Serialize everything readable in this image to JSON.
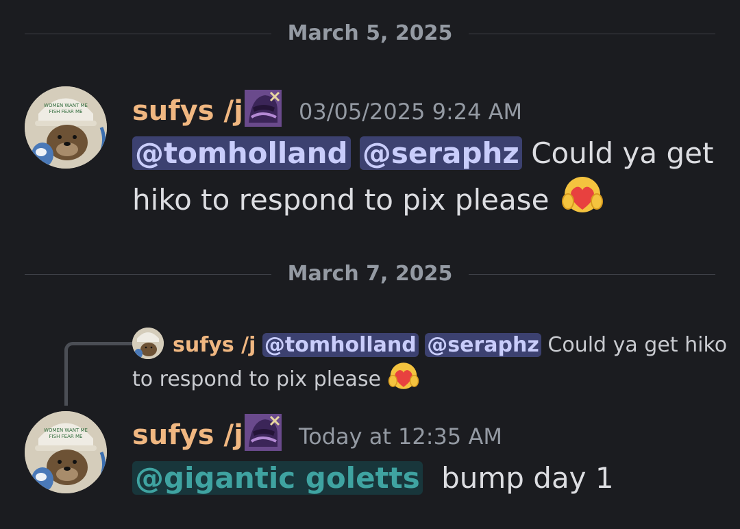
{
  "dividers": [
    {
      "label": "March 5, 2025"
    },
    {
      "label": "March 7, 2025"
    }
  ],
  "message1": {
    "author": "sufys /j",
    "timestamp": "03/05/2025 9:24 AM",
    "mentions": [
      "@tomholland",
      "@seraphz"
    ],
    "text_line1": "Could ya get",
    "text_line2": "hiko to respond to pix please",
    "emoji": "heart-hug-emoji"
  },
  "reply_preview": {
    "author": "sufys /j",
    "mentions": [
      "@tomholland",
      "@seraphz"
    ],
    "text_line1": "Could ya get hiko",
    "text_line2": "to respond to pix please",
    "emoji": "heart-hug-emoji"
  },
  "message2": {
    "author": "sufys /j",
    "timestamp": "Today at 12:35 AM",
    "role_mention": "@gigantic goletts",
    "text": "bump day 1"
  },
  "colors": {
    "background": "#1b1c20",
    "username": "#f0b781",
    "mention_bg": "#3c4170",
    "mention_fg": "#c9cdfb",
    "role_mention_bg": "#18363b",
    "role_mention_fg": "#3fa3a1"
  }
}
